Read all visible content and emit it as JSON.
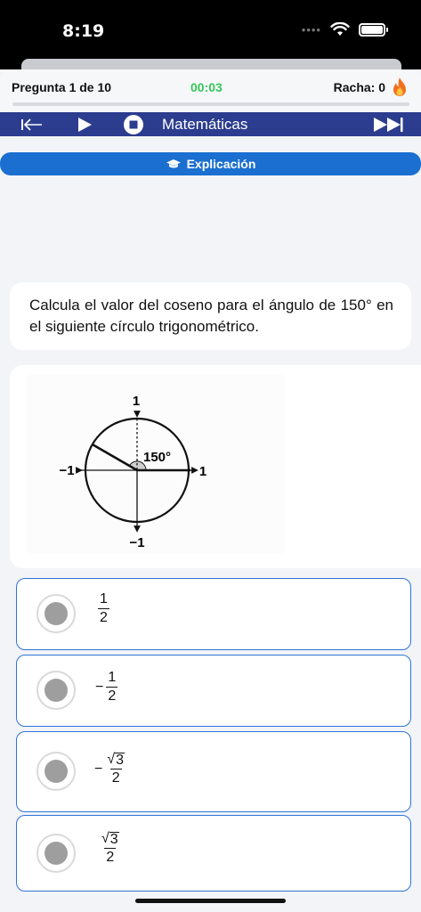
{
  "status_bar": {
    "time": "8:19",
    "signal_dots": "••••",
    "icons": [
      "wifi-icon",
      "battery-icon"
    ]
  },
  "header": {
    "question_counter": "Pregunta 1 de 10",
    "timer": "00:03",
    "streak": "Racha: 0",
    "streak_icon": "fire-icon",
    "progress": 0.0
  },
  "toolbar": {
    "subject": "Matemáticas",
    "icons": [
      "exit-icon",
      "play-icon",
      "stop-icon",
      "fast-forward-icon"
    ]
  },
  "explanation": {
    "label": "Explicación",
    "icon": "graduation-cap-icon"
  },
  "question": {
    "text": "Calcula el valor del coseno para el ángulo de 150° en el siguiente círculo trigonométrico."
  },
  "figure": {
    "top_label": "1",
    "bottom_label": "−1",
    "left_label": "−1",
    "right_label": "1",
    "angle_label": "150°"
  },
  "options": [
    {
      "sign": "",
      "numerator": "1",
      "radicand": "",
      "denominator": "2"
    },
    {
      "sign": "−",
      "numerator": "1",
      "radicand": "",
      "denominator": "2"
    },
    {
      "sign": "−",
      "numerator": "",
      "radicand": "3",
      "denominator": "2"
    },
    {
      "sign": "",
      "numerator": "",
      "radicand": "3",
      "denominator": "2"
    }
  ],
  "colors": {
    "accent": "#1a6fd0",
    "toolbar": "#2c3d8f",
    "timer": "#34c759",
    "option_border": "#2e74d8",
    "radio_fill": "#9e9e9e"
  }
}
